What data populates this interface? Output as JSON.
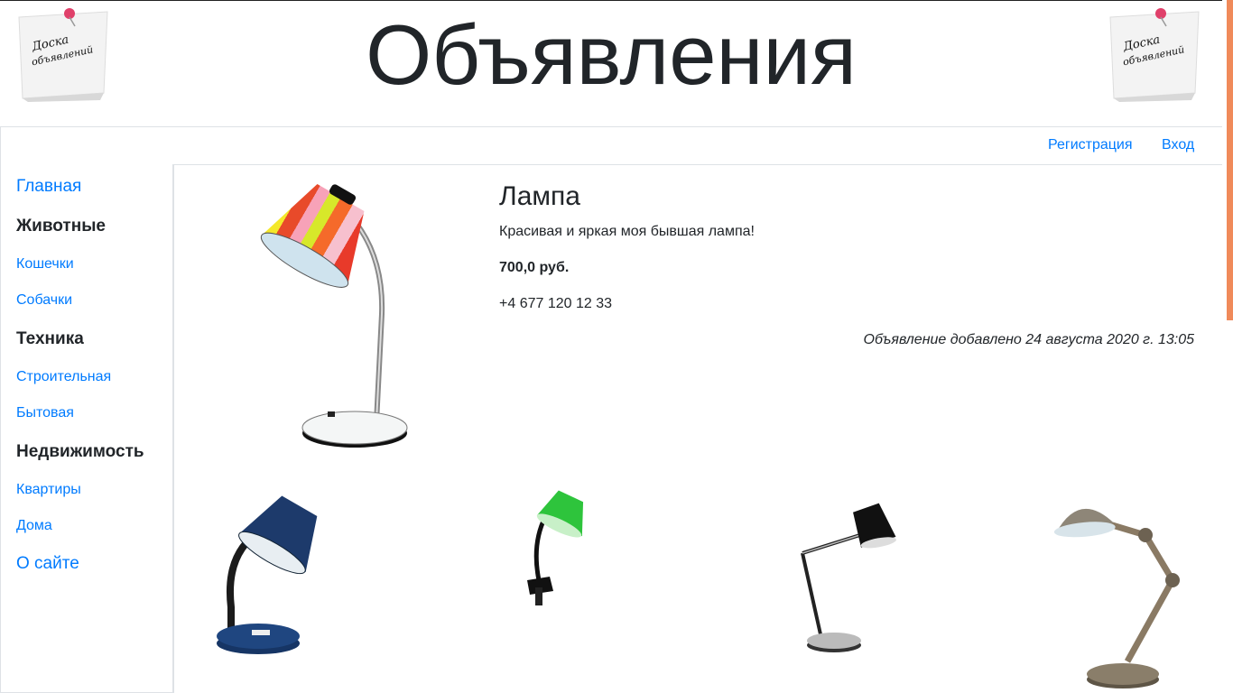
{
  "header": {
    "title": "Объявления",
    "logo_text_line1": "Доска",
    "logo_text_line2": "объявлений"
  },
  "navbar": {
    "register_label": "Регистрация",
    "login_label": "Вход"
  },
  "sidebar": {
    "home": "Главная",
    "categories": [
      {
        "title": "Животные",
        "items": [
          "Кошечки",
          "Собачки"
        ]
      },
      {
        "title": "Техника",
        "items": [
          "Строительная",
          "Бытовая"
        ]
      },
      {
        "title": "Недвижимость",
        "items": [
          "Квартиры",
          "Дома"
        ]
      }
    ],
    "about": "О сайте"
  },
  "ad": {
    "title": "Лампа",
    "description": "Красивая и яркая моя бывшая лампа!",
    "price": "700,0 руб.",
    "phone": "+4 677 120 12 33",
    "date": "Объявление добавлено 24 августа 2020 г. 13:05"
  },
  "colors": {
    "link": "#007bff",
    "text": "#212529",
    "border": "#dee2e6",
    "scroll_thumb": "#f08a5a"
  }
}
